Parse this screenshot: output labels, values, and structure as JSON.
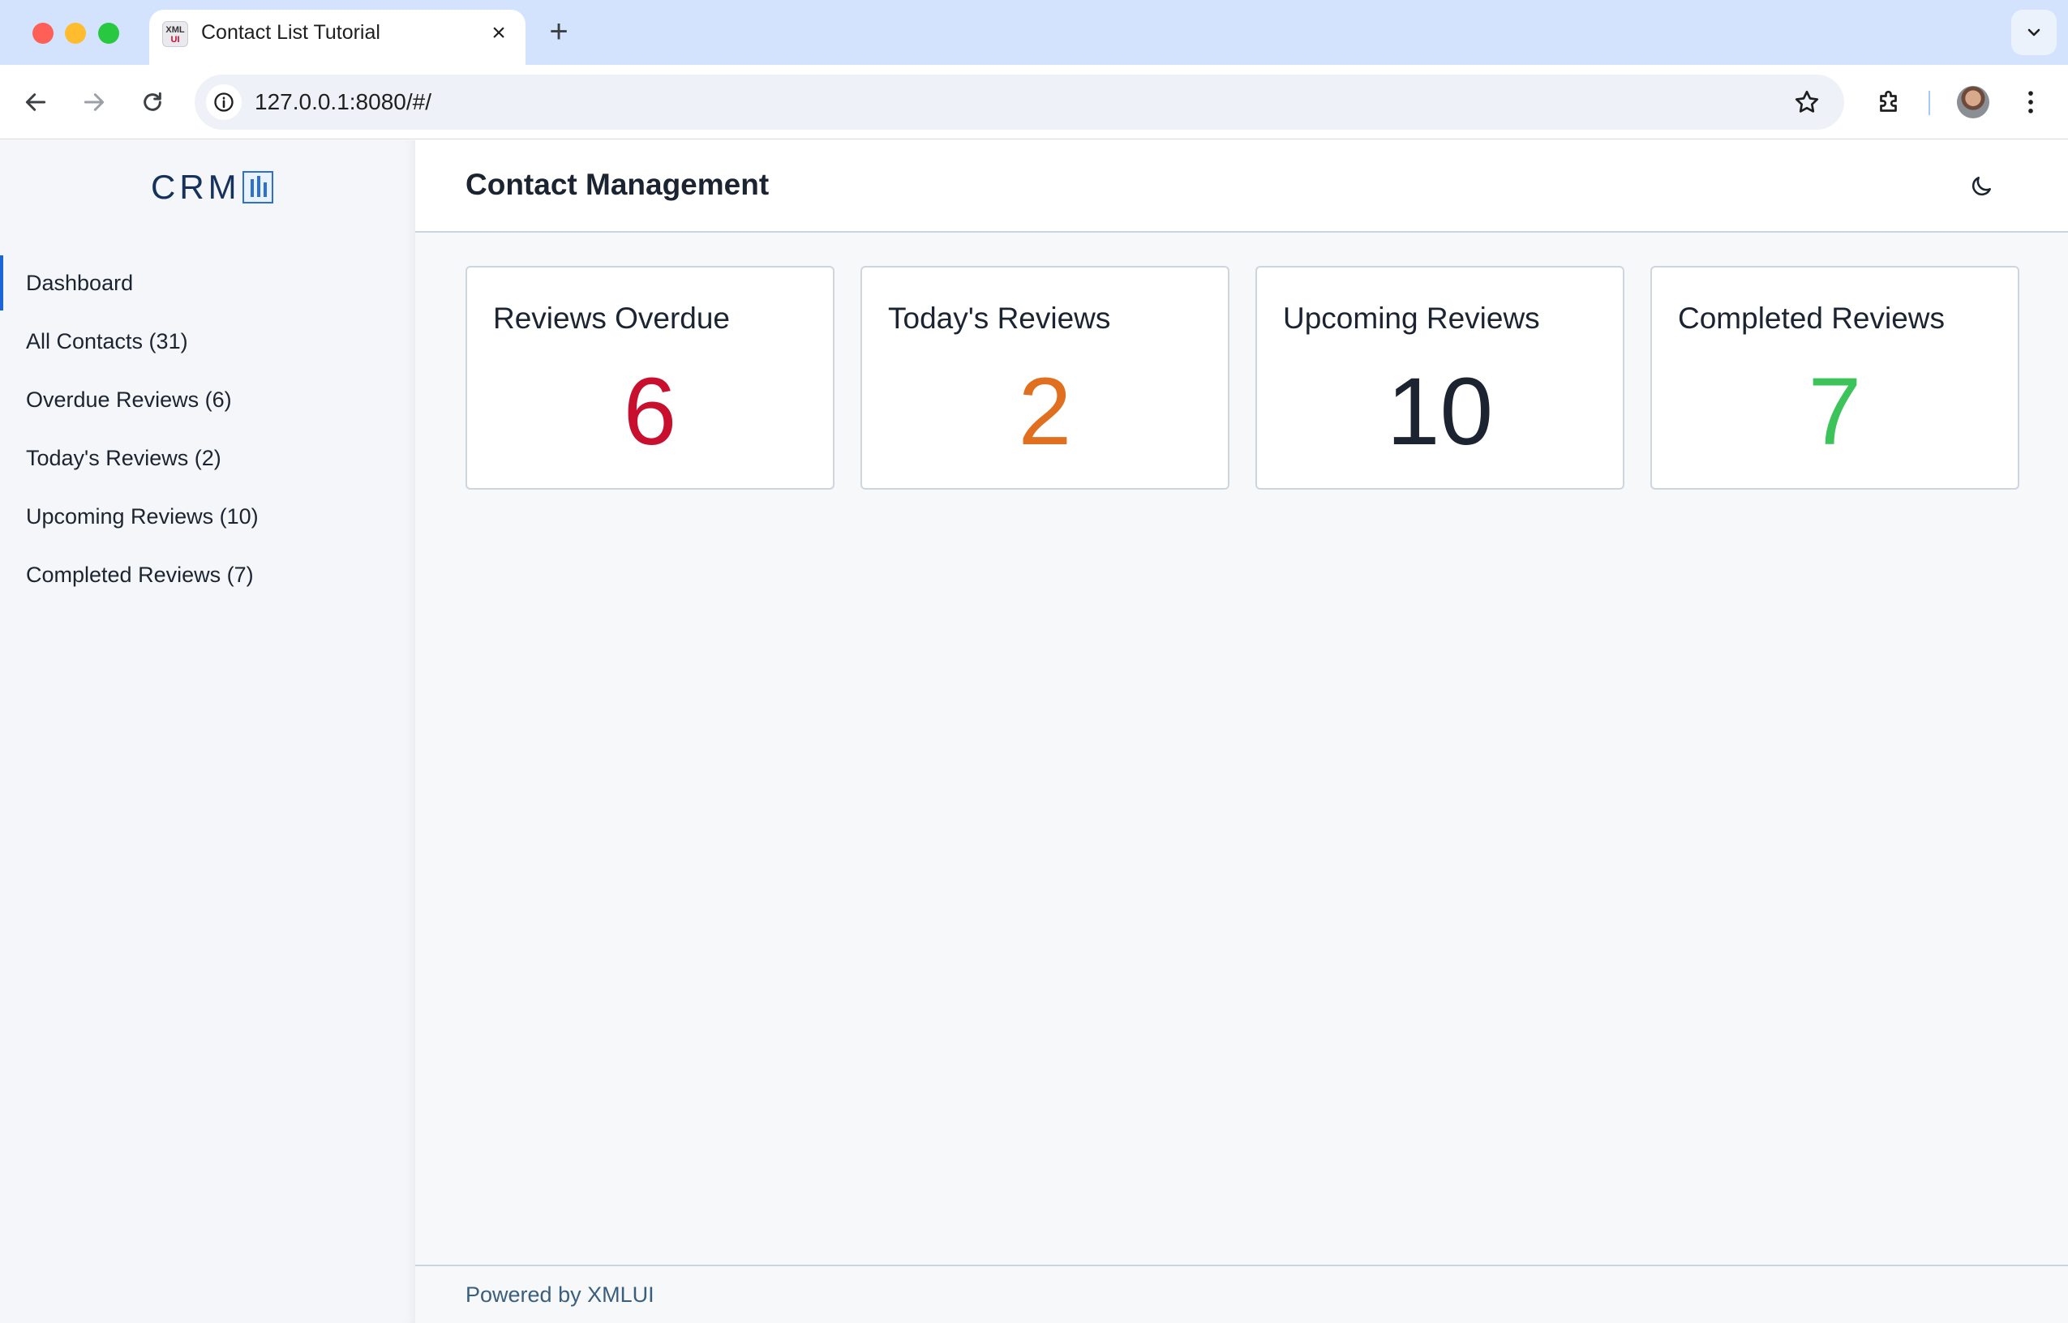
{
  "browser": {
    "tab_title": "Contact List Tutorial",
    "tab_favicon_top": "XML",
    "tab_favicon_bottom": "UI",
    "url": "127.0.0.1:8080/#/"
  },
  "sidebar": {
    "logo_text": "CRM",
    "items": [
      {
        "label": "Dashboard",
        "active": true
      },
      {
        "label": "All Contacts (31)",
        "active": false
      },
      {
        "label": "Overdue Reviews (6)",
        "active": false
      },
      {
        "label": "Today's Reviews (2)",
        "active": false
      },
      {
        "label": "Upcoming Reviews (10)",
        "active": false
      },
      {
        "label": "Completed Reviews (7)",
        "active": false
      }
    ]
  },
  "header": {
    "title": "Contact Management",
    "theme_icon": "moon-icon"
  },
  "cards": [
    {
      "title": "Reviews Overdue",
      "value": "6",
      "color": "#c8102e"
    },
    {
      "title": "Today's Reviews",
      "value": "2",
      "color": "#e07020"
    },
    {
      "title": "Upcoming Reviews",
      "value": "10",
      "color": "#1b2430"
    },
    {
      "title": "Completed Reviews",
      "value": "7",
      "color": "#3cc35a"
    }
  ],
  "footer": {
    "text": "Powered by XMLUI"
  },
  "colors": {
    "accent": "#1a66d9",
    "chrome_tabbar": "#d3e3fd"
  }
}
